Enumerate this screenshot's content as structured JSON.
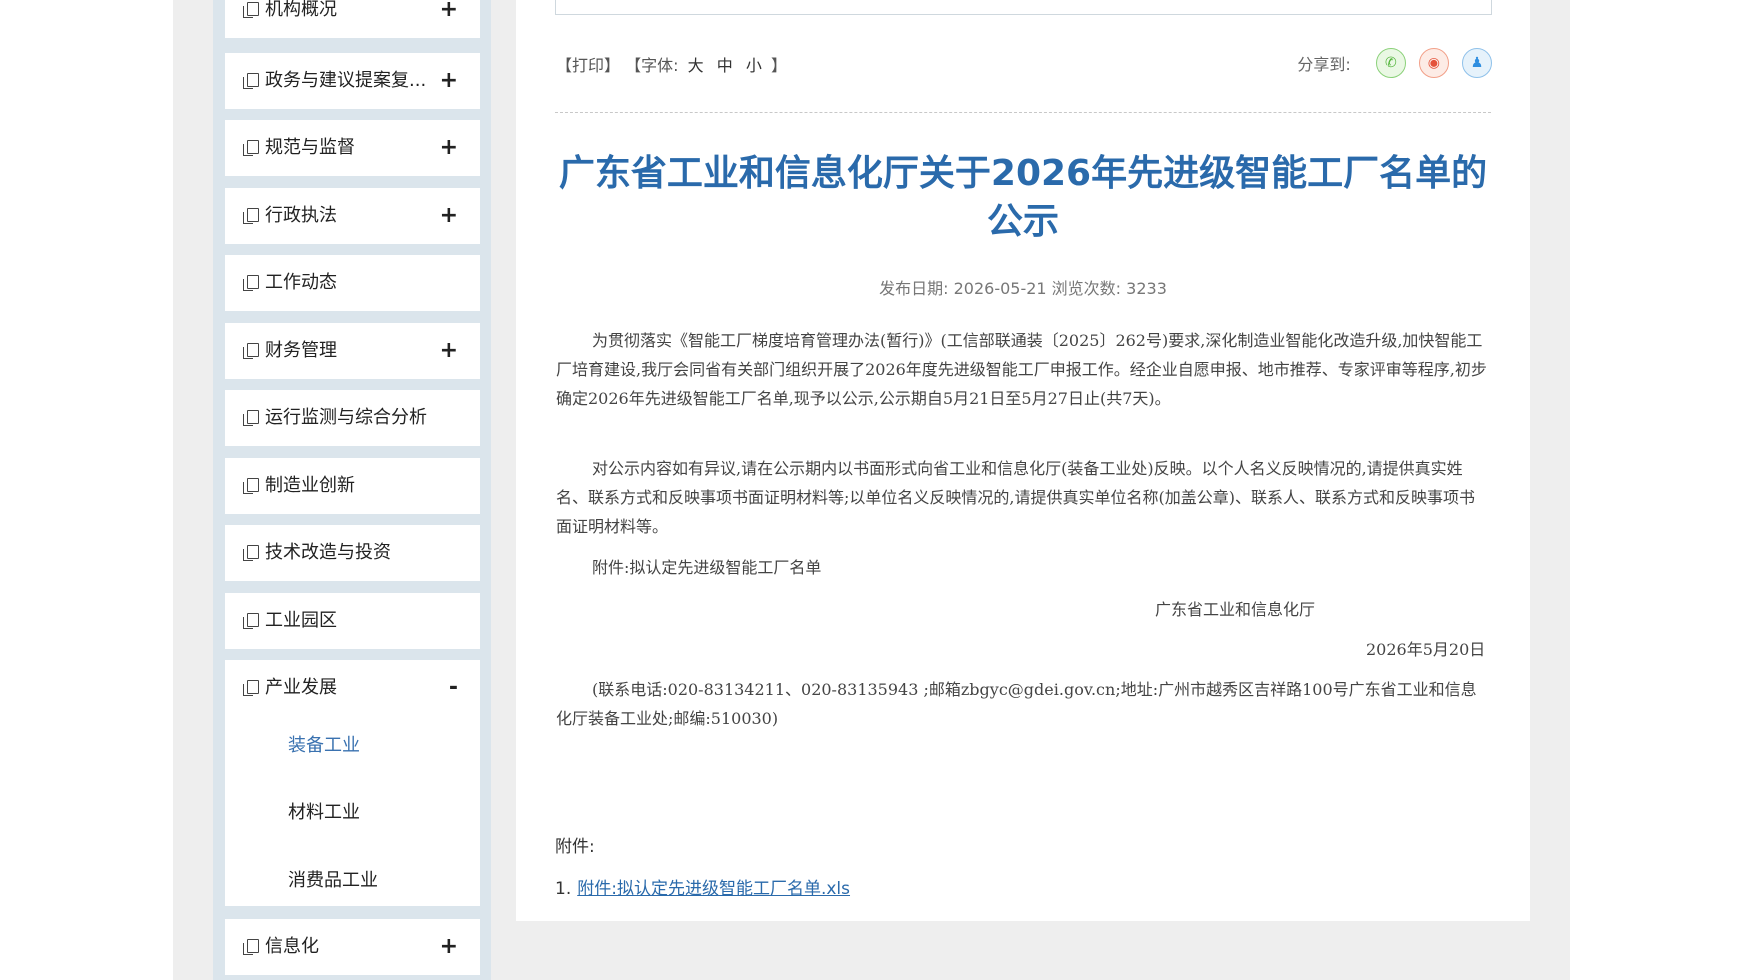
{
  "sidebar": {
    "items": [
      {
        "label": "机构概况",
        "toggle": "+"
      },
      {
        "label": "政务与建议提案复...",
        "toggle": "+"
      },
      {
        "label": "规范与监督",
        "toggle": "+"
      },
      {
        "label": "行政执法",
        "toggle": "+"
      },
      {
        "label": "工作动态",
        "toggle": ""
      },
      {
        "label": "财务管理",
        "toggle": "+"
      },
      {
        "label": "运行监测与综合分析",
        "toggle": ""
      },
      {
        "label": "制造业创新",
        "toggle": ""
      },
      {
        "label": "技术改造与投资",
        "toggle": ""
      },
      {
        "label": "工业园区",
        "toggle": ""
      },
      {
        "label": "产业发展",
        "toggle": "-"
      },
      {
        "label": "信息化",
        "toggle": "+"
      }
    ],
    "sub_items": [
      {
        "label": "装备工业",
        "active": true
      },
      {
        "label": "材料工业",
        "active": false
      },
      {
        "label": "消费品工业",
        "active": false
      }
    ]
  },
  "toolbar": {
    "print": "【打印】",
    "font_prefix": "【字体:",
    "font_large": "大",
    "font_medium": "中",
    "font_small": "小",
    "font_suffix": "】"
  },
  "share": {
    "label": "分享到:",
    "icons": [
      "wechat-icon",
      "weibo-icon",
      "qq-icon"
    ]
  },
  "article": {
    "title": "广东省工业和信息化厅关于2026年先进级智能工厂名单的公示",
    "meta": "发布日期: 2026-05-21  浏览次数: 3233",
    "p1": "为贯彻落实《智能工厂梯度培育管理办法(暂行)》(工信部联通装〔2025〕262号)要求,深化制造业智能化改造升级,加快智能工厂培育建设,我厅会同省有关部门组织开展了2026年度先进级智能工厂申报工作。经企业自愿申报、地市推荐、专家评审等程序,初步确定2026年先进级智能工厂名单,现予以公示,公示期自5月21日至5月27日止(共7天)。",
    "p2": "对公示内容如有异议,请在公示期内以书面形式向省工业和信息化厅(装备工业处)反映。以个人名义反映情况的,请提供真实姓名、联系方式和反映事项书面证明材料等;以单位名义反映情况的,请提供真实单位名称(加盖公章)、联系人、联系方式和反映事项书面证明材料等。",
    "p3": "附件:拟认定先进级智能工厂名单",
    "sign_org": "广东省工业和信息化厅",
    "sign_date": "2026年5月20日",
    "contact": "(联系电话:020-83134211、020-83135943 ;邮箱zbgyc@gdei.gov.cn;地址:广州市越秀区吉祥路100号广东省工业和信息化厅装备工业处;邮编:510030)"
  },
  "attachments": {
    "label": "附件:",
    "index": "1.",
    "link_text": "附件:拟认定先进级智能工厂名单.xls"
  },
  "colors": {
    "title": "#2a6aab",
    "link": "#2a6aab",
    "active_sub": "#3a72b0",
    "sidebar_bg": "#dbe5ec"
  }
}
